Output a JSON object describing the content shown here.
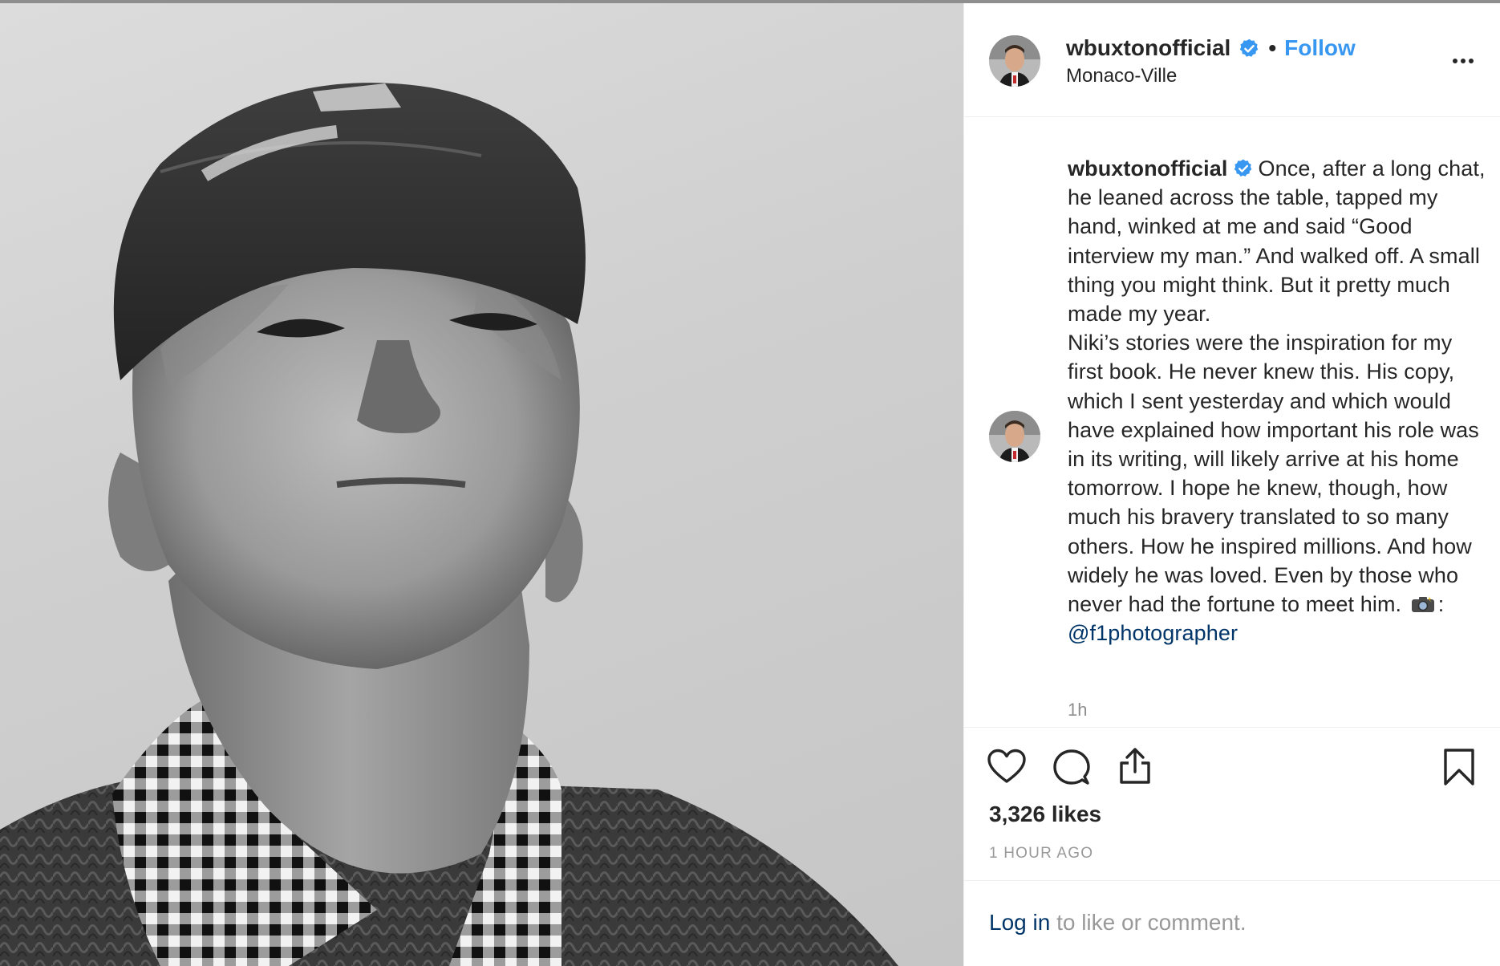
{
  "post": {
    "header": {
      "username": "wbuxtonofficial",
      "separator": "•",
      "follow_label": "Follow",
      "location": "Monaco-Ville",
      "more_icon": "more-options-icon"
    },
    "caption": {
      "username": "wbuxtonofficial",
      "text": "Once, after a long chat, he leaned across the table, tapped my hand, winked at me and said “Good interview my man.” And walked off. A small thing you might think. But it pretty much made my year.",
      "text2": "Niki’s stories were the inspiration for my first book. He never knew this. His copy, which I sent yesterday and which would have explained how important his role was in its writing, will likely arrive at his home tomorrow. I hope he knew, though, how much his bravery translated to so many others. How he inspired millions. And how widely he was loved. Even by those who never had the fortune to meet him.",
      "credit_sep": ":",
      "mention": "@f1photographer",
      "relative_time": "1h"
    },
    "actions": {
      "like_icon": "heart-icon",
      "comment_icon": "comment-icon",
      "share_icon": "share-icon",
      "save_icon": "bookmark-icon",
      "likes": "3,326 likes",
      "time_ago": "1 HOUR AGO"
    },
    "footer": {
      "login_link": "Log in",
      "login_rest": " to like or comment."
    }
  },
  "colors": {
    "accent": "#3897f0",
    "link": "#003569",
    "text": "#262626",
    "muted": "#999999",
    "verified": "#3897f0"
  }
}
